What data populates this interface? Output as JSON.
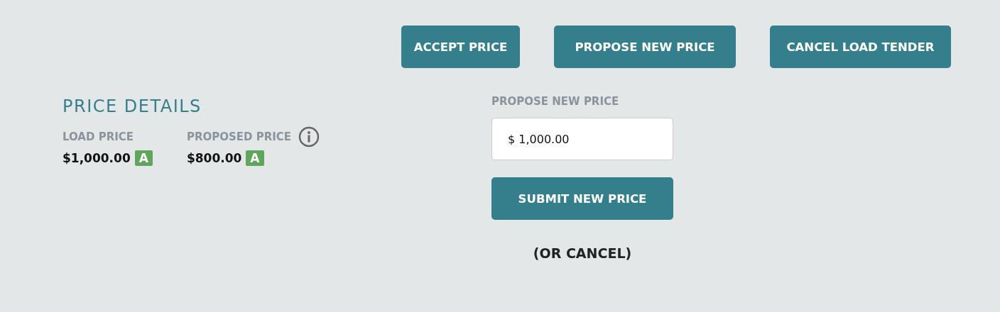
{
  "actions": [
    {
      "label": "ACCEPT PRICE"
    },
    {
      "label": "PROPOSE NEW PRICE"
    },
    {
      "label": "CANCEL LOAD TENDER"
    }
  ],
  "price_details": {
    "title": "PRICE DETAILS",
    "prices": [
      {
        "label": "LOAD PRICE",
        "value": "$1,000.00",
        "badge": "A",
        "info": false
      },
      {
        "label": "PROPOSED PRICE",
        "value": "$800.00",
        "badge": "A",
        "info": true
      }
    ]
  },
  "propose_form": {
    "label": "PROPOSE NEW PRICE",
    "value": "$ 1,000.00",
    "submit": "SUBMIT NEW PRICE",
    "cancel": "(OR CANCEL)"
  }
}
